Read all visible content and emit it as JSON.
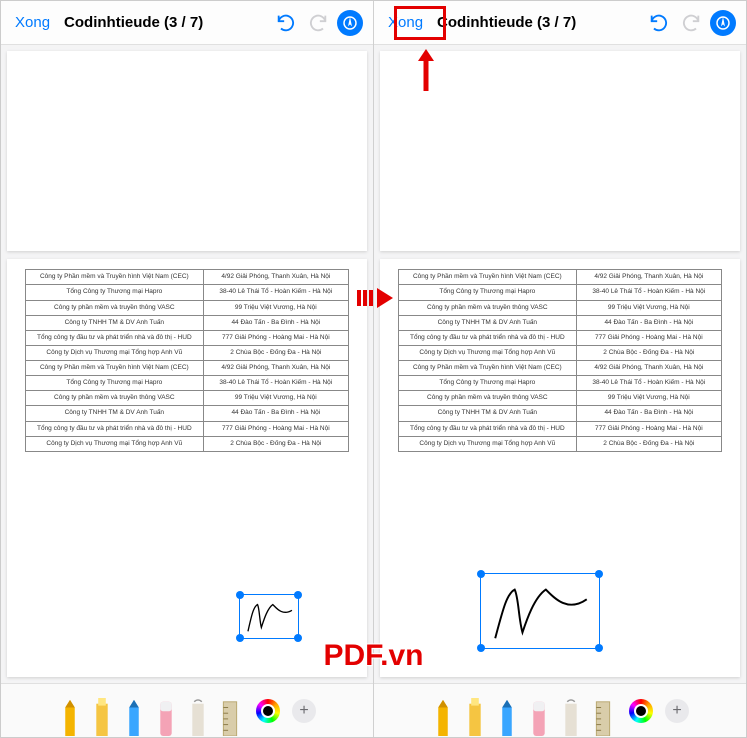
{
  "header": {
    "done_label": "Xong",
    "title": "Codinhtieude (3 / 7)"
  },
  "table_rows": [
    {
      "c1": "Công ty Phần mềm và Truyền hình Việt Nam (CEC)",
      "c2": "4/92 Giải Phóng, Thanh Xuân, Hà Nội"
    },
    {
      "c1": "Tổng Công ty Thương mại Hapro",
      "c2": "38-40 Lê Thái Tổ - Hoàn Kiếm - Hà Nội"
    },
    {
      "c1": "Công ty phần mềm và truyền thông VASC",
      "c2": "99 Triệu Việt Vương, Hà Nội"
    },
    {
      "c1": "Công ty TNHH TM & DV Anh Tuấn",
      "c2": "44 Đào Tấn - Ba Đình - Hà Nội"
    },
    {
      "c1": "Tổng công ty đầu tư và phát triển nhà và đô thị - HUD",
      "c2": "777 Giải Phóng - Hoàng Mai - Hà Nội"
    },
    {
      "c1": "Công ty Dịch vụ Thương mại Tổng hợp Anh Vũ",
      "c2": "2 Chùa Bộc - Đống Đa - Hà Nội"
    },
    {
      "c1": "Công ty Phần mềm và Truyền hình Việt Nam (CEC)",
      "c2": "4/92 Giải Phóng, Thanh Xuân, Hà Nội"
    },
    {
      "c1": "Tổng Công ty Thương mại Hapro",
      "c2": "38-40 Lê Thái Tổ - Hoàn Kiếm - Hà Nội"
    },
    {
      "c1": "Công ty phần mềm và truyền thông VASC",
      "c2": "99 Triệu Việt Vương, Hà Nội"
    },
    {
      "c1": "Công ty TNHH TM & DV Anh Tuấn",
      "c2": "44 Đào Tấn - Ba Đình - Hà Nội"
    },
    {
      "c1": "Tổng công ty đầu tư và phát triển nhà và đô thị - HUD",
      "c2": "777 Giải Phóng - Hoàng Mai - Hà Nội"
    },
    {
      "c1": "Công ty Dịch vụ Thương mại Tổng hợp Anh Vũ",
      "c2": "2 Chùa Bộc - Đống Đa - Hà Nội"
    }
  ],
  "watermark": "PDF.vn",
  "tool_colors": {
    "pen": "#f4b400",
    "marker": "#f5c542",
    "pencil": "#39a6ff",
    "eraser": "#f4a3b6",
    "lasso": "#e6e0d4",
    "ruler": "#d9cdaa"
  }
}
